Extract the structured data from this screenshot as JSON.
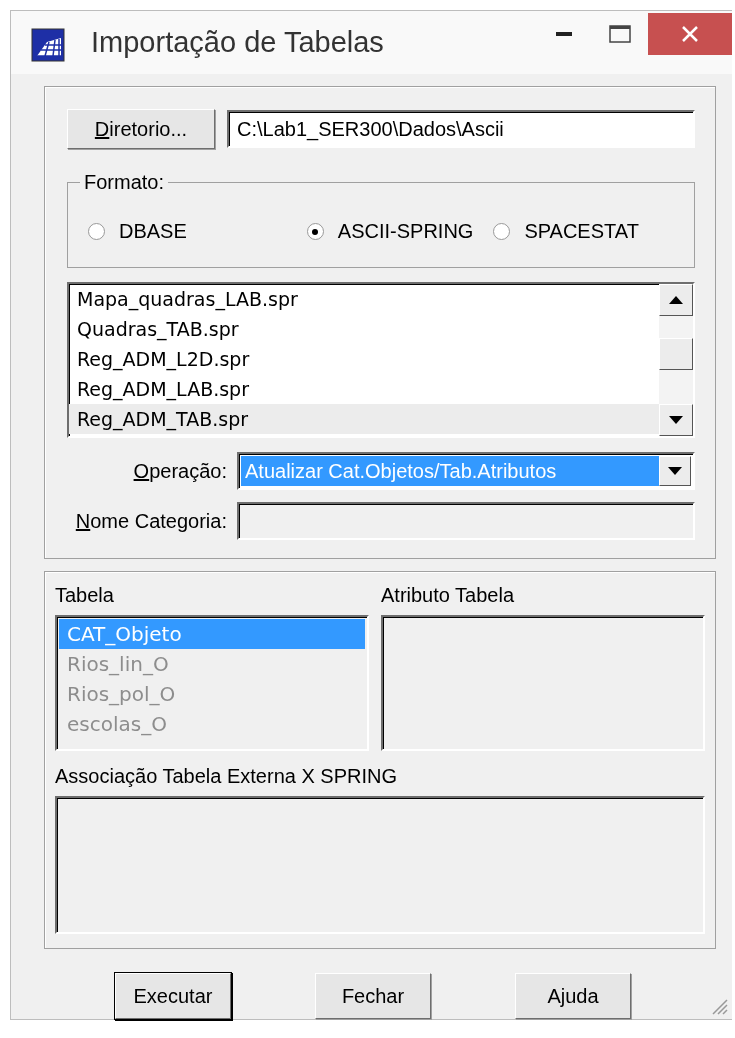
{
  "window": {
    "title": "Importação de Tabelas"
  },
  "directory": {
    "button": {
      "label": "Diretorio...",
      "mnemonic": true
    },
    "path": "C:\\Lab1_SER300\\Dados\\Ascii"
  },
  "format": {
    "title": "Formato:",
    "options": [
      {
        "label": "DBASE",
        "selected": false
      },
      {
        "label": "ASCII-SPRING",
        "selected": true
      },
      {
        "label": "SPACESTAT",
        "selected": false
      }
    ]
  },
  "files": [
    {
      "name": "Mapa_quadras_LAB.spr",
      "selected": false
    },
    {
      "name": "Quadras_TAB.spr",
      "selected": false
    },
    {
      "name": "Reg_ADM_L2D.spr",
      "selected": false
    },
    {
      "name": "Reg_ADM_LAB.spr",
      "selected": false
    },
    {
      "name": "Reg_ADM_TAB.spr",
      "selected": true
    }
  ],
  "operation": {
    "label": "Operação:",
    "mnemonic": true,
    "value": "Atualizar Cat.Objetos/Tab.Atributos"
  },
  "category": {
    "label": "Nome Categoria:",
    "mnemonic": true
  },
  "tables": {
    "title": "Tabela",
    "items": [
      {
        "name": "CAT_Objeto",
        "selected": true,
        "disabled": false
      },
      {
        "name": "Rios_lin_O",
        "selected": false,
        "disabled": true
      },
      {
        "name": "Rios_pol_O",
        "selected": false,
        "disabled": true
      },
      {
        "name": "escolas_O",
        "selected": false,
        "disabled": true
      }
    ]
  },
  "attributes": {
    "title": "Atributo Tabela"
  },
  "association": {
    "title": "Associação Tabela Externa X SPRING"
  },
  "buttons": [
    {
      "label": "Executar",
      "default": true
    },
    {
      "label": "Fechar",
      "default": false
    },
    {
      "label": "Ajuda",
      "default": false
    }
  ]
}
